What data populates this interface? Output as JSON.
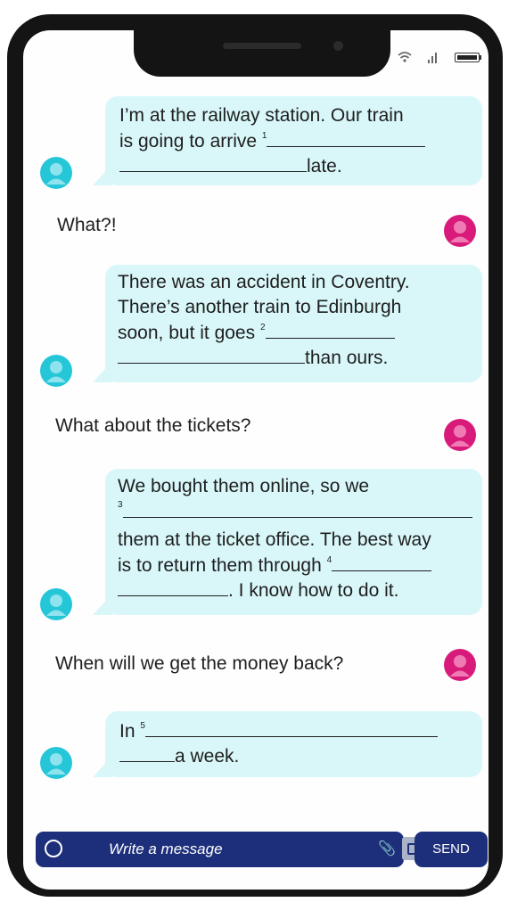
{
  "composer": {
    "placeholder": "Write a message",
    "send_label": "SEND"
  },
  "messages": [
    {
      "sender": "friend",
      "lines": [
        {
          "text": "I’m at the railway station. Our train"
        },
        {
          "before": "is going to arrive ",
          "num": "1",
          "after": ""
        },
        {
          "before": "",
          "after": "late."
        }
      ]
    },
    {
      "sender": "me",
      "text": "What?!"
    },
    {
      "sender": "friend",
      "lines": [
        {
          "text": "There was an accident in Coventry."
        },
        {
          "text": "There’s another train to Edinburgh"
        },
        {
          "before": "soon, but it goes ",
          "num": "2",
          "after": ""
        },
        {
          "before": "",
          "after": "than ours."
        }
      ]
    },
    {
      "sender": "me",
      "text": "What about the tickets?"
    },
    {
      "sender": "friend",
      "lines": [
        {
          "text": "We bought them online, so we"
        },
        {
          "num": "3"
        },
        {
          "text": "them at the ticket office. The best way"
        },
        {
          "before": "is to return them through ",
          "num": "4",
          "after": ""
        },
        {
          "before": "",
          "after": ". I know how to do it."
        }
      ]
    },
    {
      "sender": "me",
      "text": "When will we get the money back?"
    },
    {
      "sender": "friend",
      "lines": [
        {
          "before": "In ",
          "num": "5",
          "after": ""
        },
        {
          "before": "",
          "after": "a week."
        }
      ]
    }
  ],
  "colors": {
    "friend_bubble": "#d9f7f9",
    "friend_avatar": "#26c6d9",
    "me_avatar": "#d81b7a",
    "composer": "#1d2f7a"
  }
}
